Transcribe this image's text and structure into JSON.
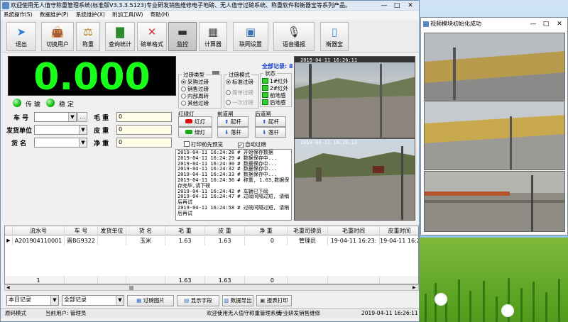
{
  "main_window": {
    "title": "欢迎使用无人值守称重管理系统(标准版V3.3.3.5123)专业研发销售维修电子地磅、无人值守过磅系统、称重软件和衡器宝等系列产品。",
    "controls": {
      "minimize": "—",
      "maximize": "□",
      "close": "✕"
    }
  },
  "menu": [
    "系统操作(S)",
    "数据维护(P)",
    "系统维护(X)",
    "附加工具(W)",
    "帮助(H)"
  ],
  "toolbar": [
    {
      "label": "退出",
      "icon": "exit-icon"
    },
    {
      "label": "切换用户",
      "icon": "user-switch-icon"
    },
    {
      "label": "称重",
      "icon": "scale-icon"
    },
    {
      "label": "查询统计",
      "icon": "chart-icon"
    },
    {
      "label": "磅单格式",
      "icon": "tools-icon"
    },
    {
      "label": "监控",
      "icon": "camera-icon"
    },
    {
      "label": "计算器",
      "icon": "calculator-icon"
    },
    {
      "label": "联网设置",
      "icon": "network-icon"
    },
    {
      "label": "语音播报",
      "icon": "microphone-icon"
    },
    {
      "label": "衡器宝",
      "icon": "phone-icon"
    }
  ],
  "weight_display": {
    "value": "0.000"
  },
  "indicators": {
    "transmit": "传 输",
    "stable": "稳 定"
  },
  "form": {
    "plate_label": "车 号",
    "plate_value": "",
    "sender_label": "发货单位",
    "sender_value": "",
    "goods_label": "货 名",
    "goods_value": "",
    "gross_label": "毛 重",
    "gross_value": "0",
    "tare_label": "皮 重",
    "tare_value": "0",
    "net_label": "净 重",
    "net_value": "0",
    "more_button": "..."
  },
  "weigh_type": {
    "title": "过磅类型",
    "options": [
      "采购过磅",
      "销售过磅",
      "内部周转",
      "其他过磅"
    ],
    "selected": 0
  },
  "weigh_mode": {
    "title": "过磅模式",
    "options": [
      "标准过磅",
      "简单过磅",
      "一次过磅"
    ],
    "selected": 0
  },
  "status_panel": {
    "title": "状态",
    "items": [
      "1#红外",
      "2#红外",
      "前地感",
      "后地感"
    ]
  },
  "total_records": "全部记录: 8",
  "traffic_light": {
    "title": "红绿灯",
    "red": "红灯",
    "green": "绿灯"
  },
  "front_gate": {
    "title": "前道闸",
    "up": "起杆",
    "down": "落杆"
  },
  "rear_gate": {
    "title": "后道闸",
    "up": "起杆",
    "down": "落杆"
  },
  "print_preview": "打印前先预览",
  "auto_weigh": "自动过磅",
  "log_lines": [
    "2019-04-11 16:24:28 # 开始保存数据",
    "2019-04-11 16:24:29 # 数据保存中...",
    "2019-04-11 16:24:30 # 数据保存中...",
    "2019-04-11 16:24:32 # 数据保存中...",
    "2019-04-11 16:24:33 # 数据保存中...",
    "2019-04-11 16:24:36 # 称重, 1.63,数据保存完毕,请下磅",
    "2019-04-11 16:24:42 # 车辆已下磅",
    "2019-04-11 16:24:47 # 过磅间隔过短, 请稍后再试",
    "2019-04-11 16:24:58 # 过磅间隔过短, 请稍后再试"
  ],
  "camera_overlays": [
    "2019-04-11 16:26:11",
    "2019-04-11 16:26:13"
  ],
  "table": {
    "columns": [
      "流水号",
      "车 号",
      "发货单位",
      "货 名",
      "毛 重",
      "皮 重",
      "净 重",
      "毛重司磅员",
      "毛重时间",
      "皮重时间"
    ],
    "rows": [
      [
        "A201904110001",
        "晋BG9322",
        "",
        "玉米",
        "1.63",
        "1.63",
        "0",
        "管理员",
        "19-04-11 16:23:",
        "19-04-11 16:23:"
      ]
    ],
    "footer": [
      "1",
      "",
      "",
      "",
      "1.63",
      "1.63",
      "0",
      "",
      "",
      ""
    ]
  },
  "bottom": {
    "range_select": "本日记录",
    "filter_select": "全部记录",
    "btn_images": "过磅图片",
    "btn_fields": "显示字段",
    "btn_export": "数据导出",
    "btn_print": "报表打印"
  },
  "statusbar": {
    "mode": "原码模式",
    "user": "当前用户: 管理员",
    "welcome": "欢迎使用无人值守称重管理系统",
    "support": "专业研发销售维修",
    "datetime": "2019-04-11 16:26:11"
  },
  "video_window": {
    "title": "视频模块初始化成功",
    "controls": {
      "minimize": "—",
      "maximize": "□",
      "close": "✕"
    }
  }
}
